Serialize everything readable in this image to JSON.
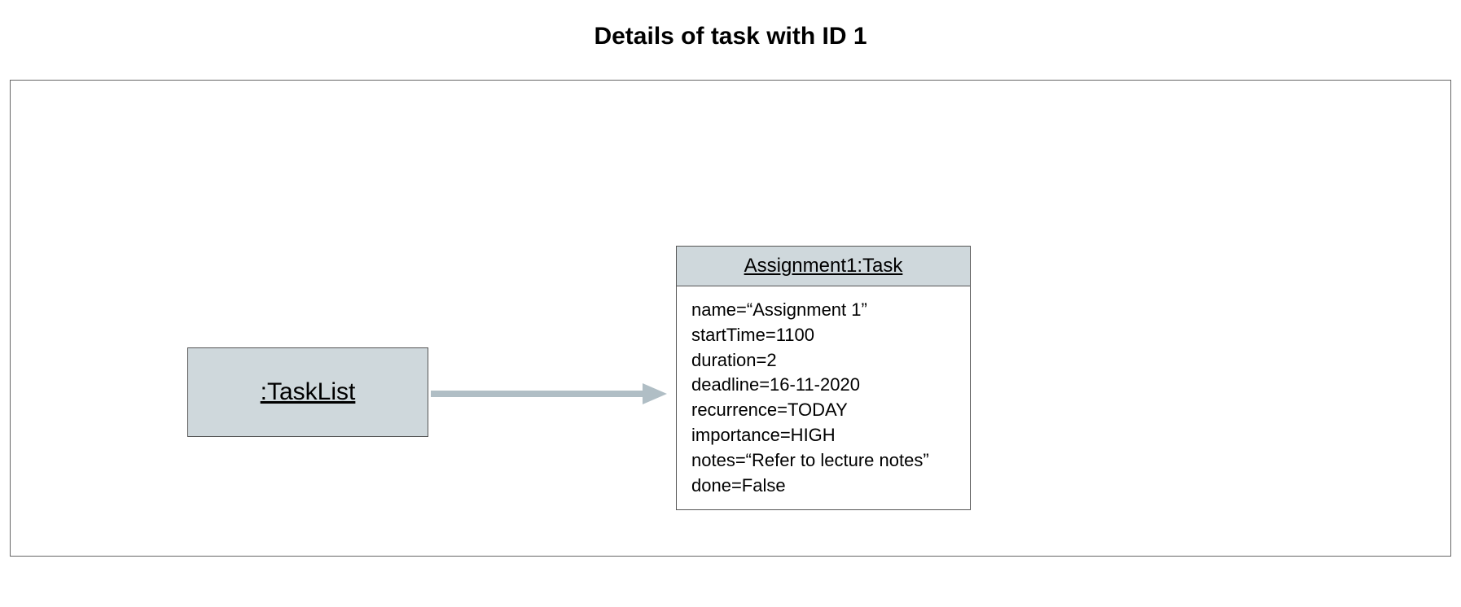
{
  "title": "Details of task with ID 1",
  "tasklist": {
    "label": ":TaskList"
  },
  "task": {
    "header": "Assignment1:Task",
    "attributes": [
      "name=“Assignment 1”",
      "startTime=1100",
      "duration=2",
      "deadline=16-11-2020",
      "recurrence=TODAY",
      "importance=HIGH",
      "notes=“Refer to lecture notes”",
      "done=False"
    ]
  },
  "colors": {
    "boxFill": "#cfd8dc",
    "arrow": "#b0bec5",
    "border": "#555555"
  }
}
